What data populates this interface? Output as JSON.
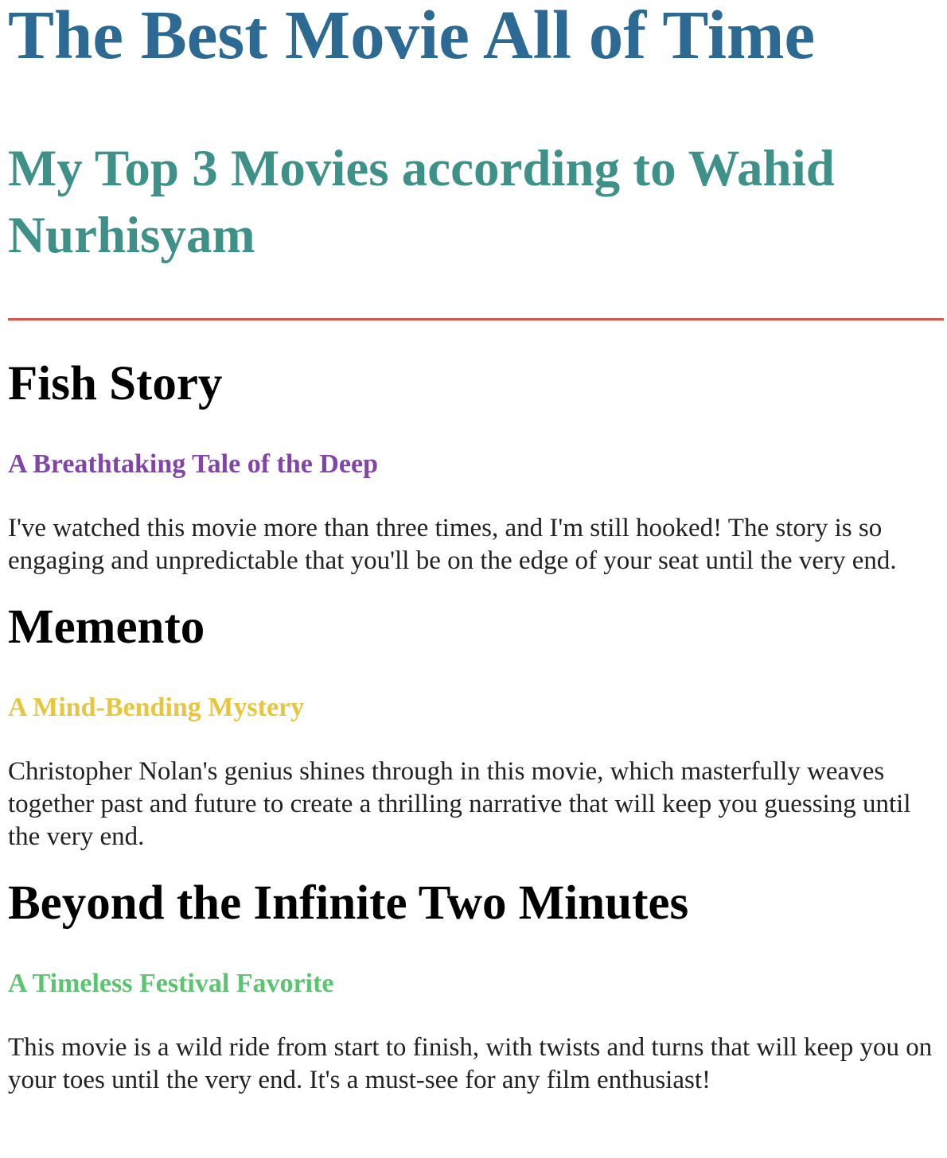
{
  "page": {
    "title": "The Best Movie All of Time",
    "subtitle": "My Top 3 Movies according to Wahid Nurhisyam"
  },
  "colors": {
    "title": "#2c6a93",
    "subtitle": "#3e9188",
    "divider": "#d9544a"
  },
  "movies": [
    {
      "title": "Fish Story",
      "tagline": "A Breathtaking Tale of the Deep",
      "tagline_color": "#8244a8",
      "description": "I've watched this movie more than three times, and I'm still hooked! The story is so engaging and unpredictable that you'll be on the edge of your seat until the very end."
    },
    {
      "title": "Memento",
      "tagline": "A Mind-Bending Mystery",
      "tagline_color": "#e8c53e",
      "description": "Christopher Nolan's genius shines through in this movie, which masterfully weaves together past and future to create a thrilling narrative that will keep you guessing until the very end."
    },
    {
      "title": "Beyond the Infinite Two Minutes",
      "tagline": "A Timeless Festival Favorite",
      "tagline_color": "#5cc470",
      "description": "This movie is a wild ride from start to finish, with twists and turns that will keep you on your toes until the very end. It's a must-see for any film enthusiast!"
    }
  ]
}
